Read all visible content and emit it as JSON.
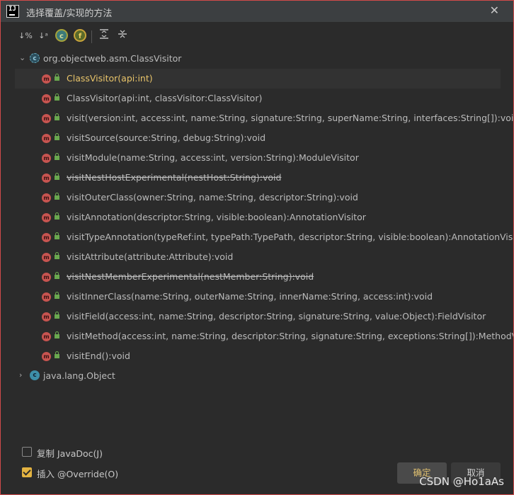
{
  "window": {
    "title": "选择覆盖/实现的方法",
    "app_logo_text": "IJ"
  },
  "toolbar": {
    "icons": [
      "sort-by-visibility-icon",
      "sort-alphabetically-icon",
      "show-classes-icon",
      "show-fields-icon",
      "expand-all-icon",
      "collapse-all-icon"
    ],
    "labels": {
      "sort_visibility": "↓%",
      "sort_alpha": "↓ᵃ",
      "class_letter": "c",
      "field_letter": "f"
    }
  },
  "tree": {
    "root_class": "org.objectweb.asm.ClassVisitor",
    "methods": [
      {
        "label": "ClassVisitor(api:int)",
        "selected": true,
        "deprecated": false
      },
      {
        "label": "ClassVisitor(api:int, classVisitor:ClassVisitor)",
        "selected": false,
        "deprecated": false
      },
      {
        "label": "visit(version:int, access:int, name:String, signature:String, superName:String, interfaces:String[]):void",
        "selected": false,
        "deprecated": false
      },
      {
        "label": "visitSource(source:String, debug:String):void",
        "selected": false,
        "deprecated": false
      },
      {
        "label": "visitModule(name:String, access:int, version:String):ModuleVisitor",
        "selected": false,
        "deprecated": false
      },
      {
        "label": "visitNestHostExperimental(nestHost:String):void",
        "selected": false,
        "deprecated": true
      },
      {
        "label": "visitOuterClass(owner:String, name:String, descriptor:String):void",
        "selected": false,
        "deprecated": false
      },
      {
        "label": "visitAnnotation(descriptor:String, visible:boolean):AnnotationVisitor",
        "selected": false,
        "deprecated": false
      },
      {
        "label": "visitTypeAnnotation(typeRef:int, typePath:TypePath, descriptor:String, visible:boolean):AnnotationVisitor",
        "selected": false,
        "deprecated": false
      },
      {
        "label": "visitAttribute(attribute:Attribute):void",
        "selected": false,
        "deprecated": false
      },
      {
        "label": "visitNestMemberExperimental(nestMember:String):void",
        "selected": false,
        "deprecated": true
      },
      {
        "label": "visitInnerClass(name:String, outerName:String, innerName:String, access:int):void",
        "selected": false,
        "deprecated": false
      },
      {
        "label": "visitField(access:int, name:String, descriptor:String, signature:String, value:Object):FieldVisitor",
        "selected": false,
        "deprecated": false
      },
      {
        "label": "visitMethod(access:int, name:String, descriptor:String, signature:String, exceptions:String[]):MethodVisitor",
        "selected": false,
        "deprecated": false
      },
      {
        "label": "visitEnd():void",
        "selected": false,
        "deprecated": false
      }
    ],
    "method_icon_letter": "m",
    "class_icon_letter": "c",
    "second_class": "java.lang.Object"
  },
  "options": {
    "copy_javadoc": {
      "label": "复制 JavaDoc(J)",
      "checked": false
    },
    "insert_override": {
      "label": "插入 @Override(O)",
      "checked": true
    }
  },
  "buttons": {
    "ok": "确定",
    "cancel": "取消"
  },
  "watermark": "CSDN @Ho1aAs",
  "colors": {
    "border_accent": "#d14a4a",
    "selected_text": "#e8c46a",
    "method_icon": "#c75450",
    "class_icon": "#3d8fa8",
    "checkbox_checked": "#e3b341"
  }
}
